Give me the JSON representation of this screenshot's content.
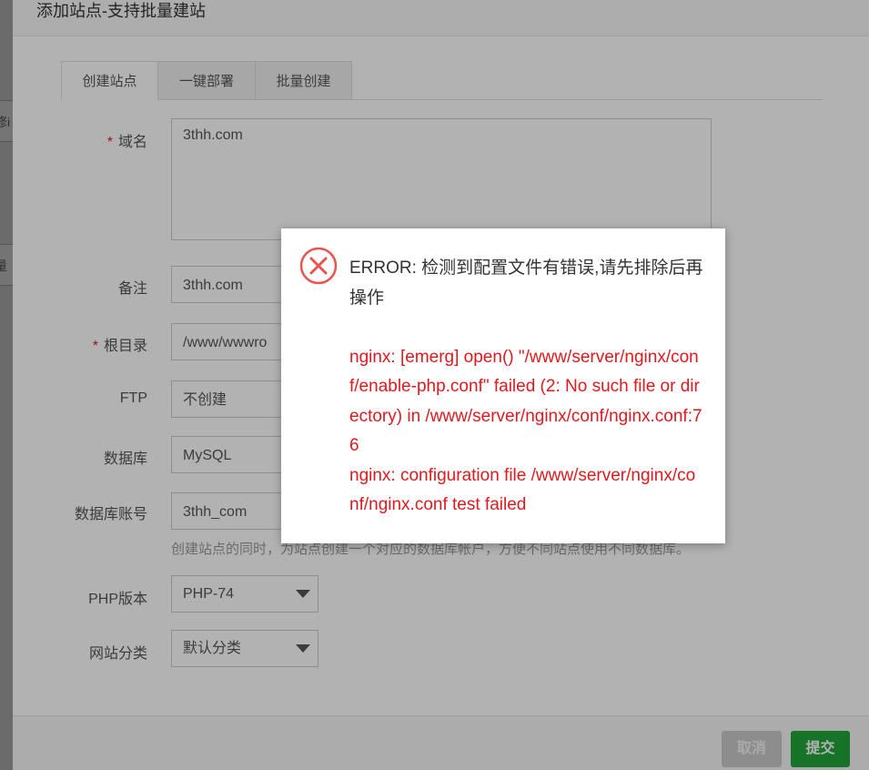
{
  "background": {
    "row1_fragment": "修i",
    "row2_fragment": "量"
  },
  "dialog": {
    "title": "添加站点-支持批量建站",
    "tabs": [
      {
        "label": "创建站点",
        "active": true
      },
      {
        "label": "一键部署",
        "active": false
      },
      {
        "label": "批量创建",
        "active": false
      }
    ],
    "form": {
      "domain": {
        "label": "域名",
        "required": true,
        "value": "3thh.com"
      },
      "remark": {
        "label": "备注",
        "value": "3thh.com"
      },
      "root": {
        "label": "根目录",
        "required": true,
        "value": "/www/wwwro"
      },
      "ftp": {
        "label": "FTP",
        "value": "不创建"
      },
      "database": {
        "label": "数据库",
        "value": "MySQL"
      },
      "db_account": {
        "label": "数据库账号",
        "value": "3thh_com"
      },
      "hint": "创建站点的同时，为站点创建一个对应的数据库帐户，方便不同站点使用不同数据库。",
      "php_version": {
        "label": "PHP版本",
        "value": "PHP-74"
      },
      "site_category": {
        "label": "网站分类",
        "value": "默认分类"
      }
    },
    "footer": {
      "cancel_label": "取消",
      "submit_label": "提交"
    }
  },
  "error_popup": {
    "icon": "error-circle-x-icon",
    "message": "ERROR: 检测到配置文件有错误,请先排除后再操作",
    "detail_line1": "nginx: [emerg] open() \"/www/server/nginx/conf/enable-php.conf\" failed (2: No such file or directory) in /www/server/nginx/conf/nginx.conf:76",
    "detail_line2": "nginx: configuration file /www/server/nginx/conf/nginx.conf test failed"
  },
  "colors": {
    "error_red": "#e0191e",
    "submit_green": "#20a53a",
    "required_red": "#e02020"
  }
}
